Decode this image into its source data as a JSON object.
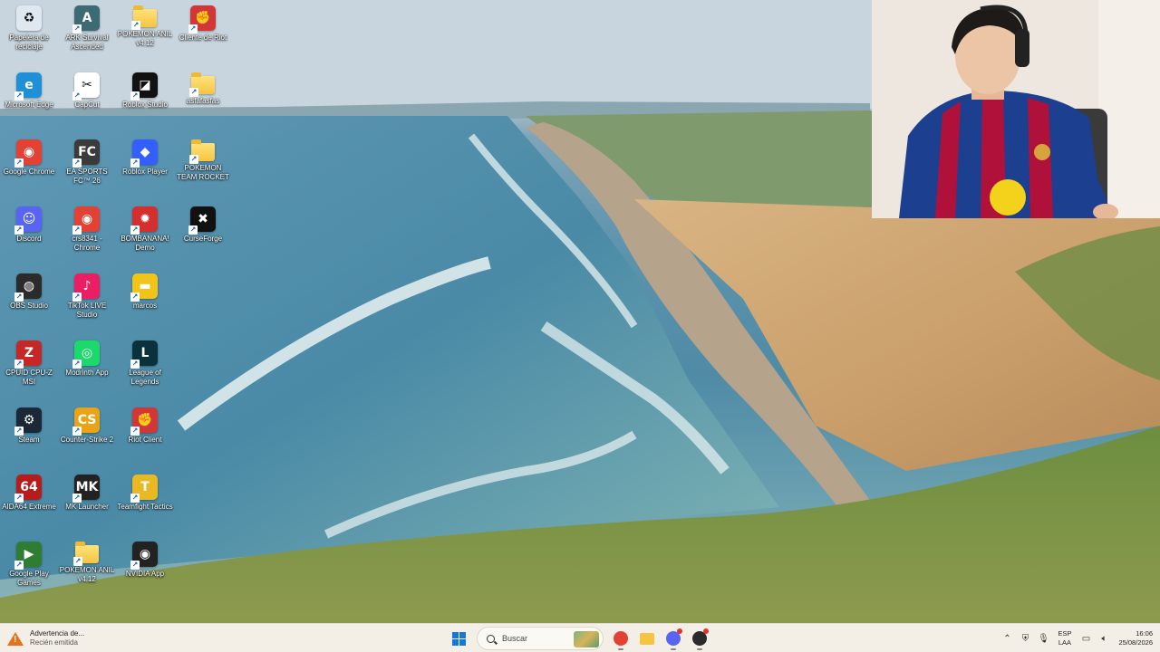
{
  "desktop": {
    "icons": [
      {
        "label": "Papelera de reciclaje",
        "icon": "recycle-bin-icon",
        "color": "#dfe8f0",
        "glyph": "♻"
      },
      {
        "label": "Microsoft Edge",
        "icon": "edge-icon",
        "color": "#1f8fd6",
        "glyph": "e"
      },
      {
        "label": "Google Chrome",
        "icon": "chrome-icon",
        "color": "#e34133",
        "glyph": "◉"
      },
      {
        "label": "Discord",
        "icon": "discord-icon",
        "color": "#5865f2",
        "glyph": "☺"
      },
      {
        "label": "OBS Studio",
        "icon": "obs-icon",
        "color": "#2b2b2b",
        "glyph": "◍"
      },
      {
        "label": "CPUID CPU-Z MSI",
        "icon": "cpuz-icon",
        "color": "#c62828",
        "glyph": "Z"
      },
      {
        "label": "Steam",
        "icon": "steam-icon",
        "color": "#1b2838",
        "glyph": "⚙"
      },
      {
        "label": "AIDA64 Extreme",
        "icon": "aida64-icon",
        "color": "#b71c1c",
        "glyph": "64"
      },
      {
        "label": "Google Play Games",
        "icon": "play-games-icon",
        "color": "#2e7d32",
        "glyph": "▶"
      },
      {
        "label": "ARK Survival Ascended",
        "icon": "ark-icon",
        "color": "#3d6b73",
        "glyph": "A"
      },
      {
        "label": "CapCut",
        "icon": "capcut-icon",
        "color": "#ffffff",
        "glyph": "✂"
      },
      {
        "label": "EA SPORTS FC™ 26",
        "icon": "eafc-icon",
        "color": "#3b3b3b",
        "glyph": "FC"
      },
      {
        "label": "crs8341 - Chrome",
        "icon": "chrome-profile-icon",
        "color": "#e34133",
        "glyph": "◉"
      },
      {
        "label": "TikTok LIVE Studio",
        "icon": "tiktok-icon",
        "color": "#e91e63",
        "glyph": "♪"
      },
      {
        "label": "Modrinth App",
        "icon": "modrinth-icon",
        "color": "#1bd96a",
        "glyph": "◎"
      },
      {
        "label": "Counter-Strike 2",
        "icon": "cs2-icon",
        "color": "#e8a317",
        "glyph": "CS"
      },
      {
        "label": "MK Launcher",
        "icon": "mk-launcher-icon",
        "color": "#222222",
        "glyph": "MK"
      },
      {
        "label": "POKEMON ANIL v4.12",
        "icon": "folder-icon",
        "color": "#f5c542",
        "glyph": ""
      },
      {
        "label": "POKEMON ANIL v4.12",
        "icon": "folder-icon",
        "color": "#f5c542",
        "glyph": ""
      },
      {
        "label": "Roblox Studio",
        "icon": "roblox-studio-icon",
        "color": "#111111",
        "glyph": "◪"
      },
      {
        "label": "Roblox Player",
        "icon": "roblox-player-icon",
        "color": "#335fff",
        "glyph": "◆"
      },
      {
        "label": "BOMBANANA! Demo",
        "icon": "bombanana-icon",
        "color": "#d32f2f",
        "glyph": "✹"
      },
      {
        "label": "marcos",
        "icon": "marcos-file-icon",
        "color": "#f0c419",
        "glyph": "▬"
      },
      {
        "label": "League of Legends",
        "icon": "lol-icon",
        "color": "#0a323c",
        "glyph": "L"
      },
      {
        "label": "Riot Client",
        "icon": "riot-client-icon",
        "color": "#d13639",
        "glyph": "✊"
      },
      {
        "label": "Teamfight Tactics",
        "icon": "tft-icon",
        "color": "#e8b923",
        "glyph": "T"
      },
      {
        "label": "NVIDIA App",
        "icon": "nvidia-icon",
        "color": "#222222",
        "glyph": "◉"
      },
      {
        "label": "Cliente de Riot",
        "icon": "riot-client-icon",
        "color": "#d13639",
        "glyph": "✊"
      },
      {
        "label": "asfafasfas",
        "icon": "folder-icon",
        "color": "#f5c542",
        "glyph": ""
      },
      {
        "label": "POKEMON TEAM ROCKET",
        "icon": "folder-icon",
        "color": "#f5c542",
        "glyph": ""
      },
      {
        "label": "CurseForge",
        "icon": "curseforge-icon",
        "color": "#111111",
        "glyph": "✖"
      }
    ]
  },
  "taskbar": {
    "notification": {
      "title": "Advertencia de...",
      "subtitle": "Recién emitida"
    },
    "search_placeholder": "Buscar",
    "apps": [
      {
        "name": "chrome-taskbar-icon",
        "color": "#e34133",
        "active": true,
        "badge": false
      },
      {
        "name": "file-explorer-taskbar-icon",
        "color": "#f5c542",
        "active": false,
        "badge": false
      },
      {
        "name": "discord-taskbar-icon",
        "color": "#5865f2",
        "active": true,
        "badge": true
      },
      {
        "name": "obs-taskbar-icon",
        "color": "#2b2b2b",
        "active": true,
        "badge": true
      }
    ],
    "tray": {
      "language_line1": "ESP",
      "language_line2": "LAA",
      "time": "16:06",
      "date": "25/08/2026"
    }
  }
}
